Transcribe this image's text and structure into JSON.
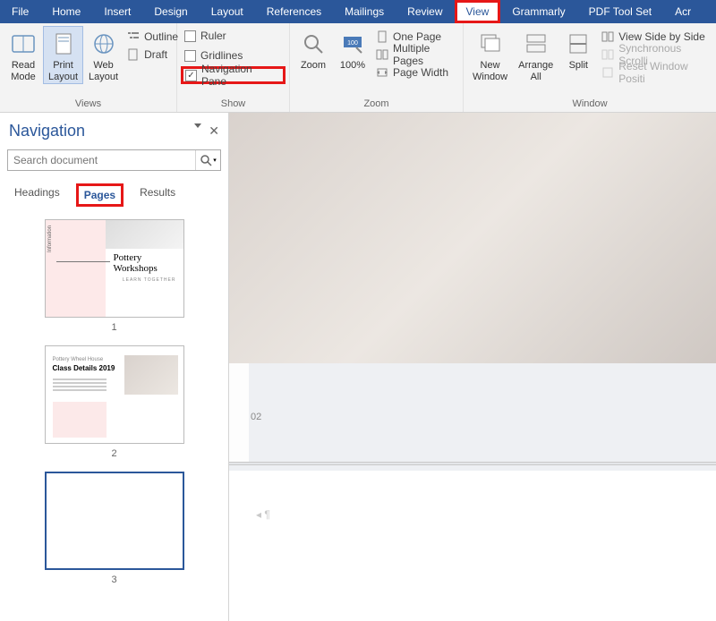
{
  "tabs": {
    "file": "File",
    "home": "Home",
    "insert": "Insert",
    "design": "Design",
    "layout": "Layout",
    "references": "References",
    "mailings": "Mailings",
    "review": "Review",
    "view": "View",
    "grammarly": "Grammarly",
    "pdftoolset": "PDF Tool Set",
    "acrobat_partial": "Acr"
  },
  "ribbon": {
    "views": {
      "read_mode": "Read\nMode",
      "print_layout": "Print\nLayout",
      "web_layout": "Web\nLayout",
      "outline": "Outline",
      "draft": "Draft",
      "label": "Views"
    },
    "show": {
      "ruler": "Ruler",
      "gridlines": "Gridlines",
      "nav_pane": "Navigation Pane",
      "label": "Show"
    },
    "zoom": {
      "zoom": "Zoom",
      "hundred": "100%",
      "one_page": "One Page",
      "multiple_pages": "Multiple Pages",
      "page_width": "Page Width",
      "label": "Zoom"
    },
    "window": {
      "new_window": "New\nWindow",
      "arrange_all": "Arrange\nAll",
      "split": "Split",
      "side_by_side": "View Side by Side",
      "sync_scroll": "Synchronous Scrolli",
      "reset_pos": "Reset Window Positi",
      "label": "Window"
    }
  },
  "nav": {
    "title": "Navigation",
    "search_placeholder": "Search document",
    "tabs": {
      "headings": "Headings",
      "pages": "Pages",
      "results": "Results"
    },
    "thumbs": [
      "1",
      "2",
      "3"
    ],
    "thumb1": {
      "title": "Pottery\nWorkshops",
      "sub": "LEARN TOGETHER",
      "info": "Information"
    },
    "thumb2": {
      "kicker": "Pottery Wheel House",
      "title": "Class Details 2019"
    }
  },
  "doc": {
    "page_num": "02"
  }
}
